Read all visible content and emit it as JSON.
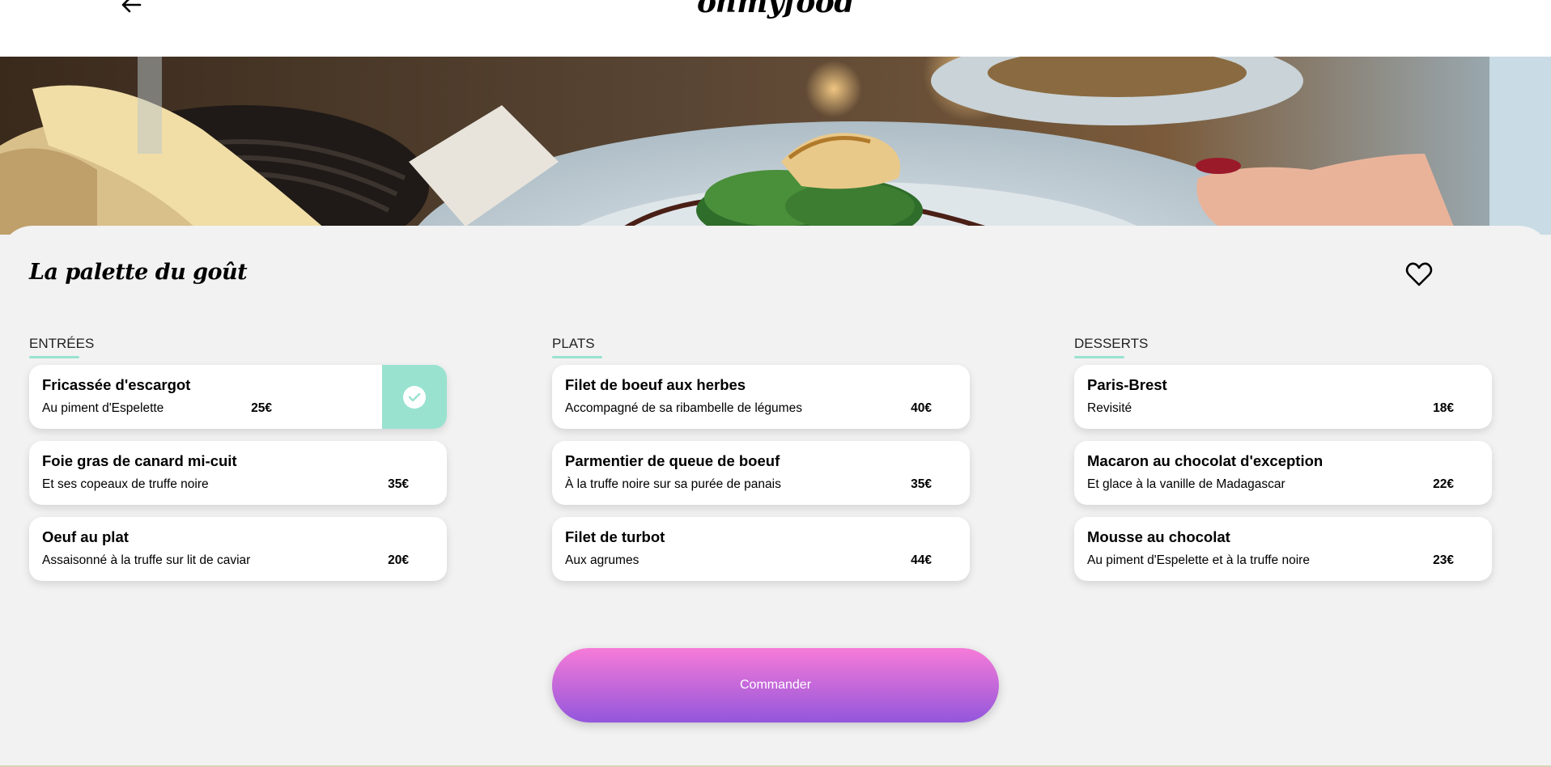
{
  "header": {
    "back_icon": "arrow-left-icon",
    "logo": "ohmyfood"
  },
  "hero": {
    "image": "restaurant-dish-photo"
  },
  "restaurant": {
    "name": "La palette du goût",
    "favorite_icon": "heart-outline-icon"
  },
  "menu": {
    "sections": [
      {
        "title": "ENTRÉES",
        "items": [
          {
            "name": "Fricassée d'escargot",
            "description": "Au piment d'Espelette",
            "price": "25€",
            "selected": true
          },
          {
            "name": "Foie gras de canard mi-cuit",
            "description": "Et ses copeaux de truffe noire",
            "price": "35€",
            "selected": false
          },
          {
            "name": "Oeuf au plat",
            "description": "Assaisonné à la truffe sur lit de caviar",
            "price": "20€",
            "selected": false
          }
        ]
      },
      {
        "title": "PLATS",
        "items": [
          {
            "name": "Filet de boeuf aux herbes",
            "description": "Accompagné de sa ribambelle de légumes",
            "price": "40€",
            "selected": false
          },
          {
            "name": "Parmentier de queue de boeuf",
            "description": "À la truffe noire sur sa purée de panais",
            "price": "35€",
            "selected": false
          },
          {
            "name": "Filet de turbot",
            "description": "Aux agrumes",
            "price": "44€",
            "selected": false
          }
        ]
      },
      {
        "title": "DESSERTS",
        "items": [
          {
            "name": "Paris-Brest",
            "description": "Revisité",
            "price": "18€",
            "selected": false
          },
          {
            "name": "Macaron au chocolat d'exception",
            "description": "Et glace à la vanille de Madagascar",
            "price": "22€",
            "selected": false
          },
          {
            "name": "Mousse au chocolat",
            "description": "Au piment d'Espelette et à la truffe noire",
            "price": "23€",
            "selected": false
          }
        ]
      }
    ]
  },
  "order_button": {
    "label": "Commander"
  },
  "colors": {
    "accent": "#99e2d0",
    "gradient_top": "#f67bd8",
    "gradient_bottom": "#9356dc",
    "background": "#f2f2f2"
  }
}
